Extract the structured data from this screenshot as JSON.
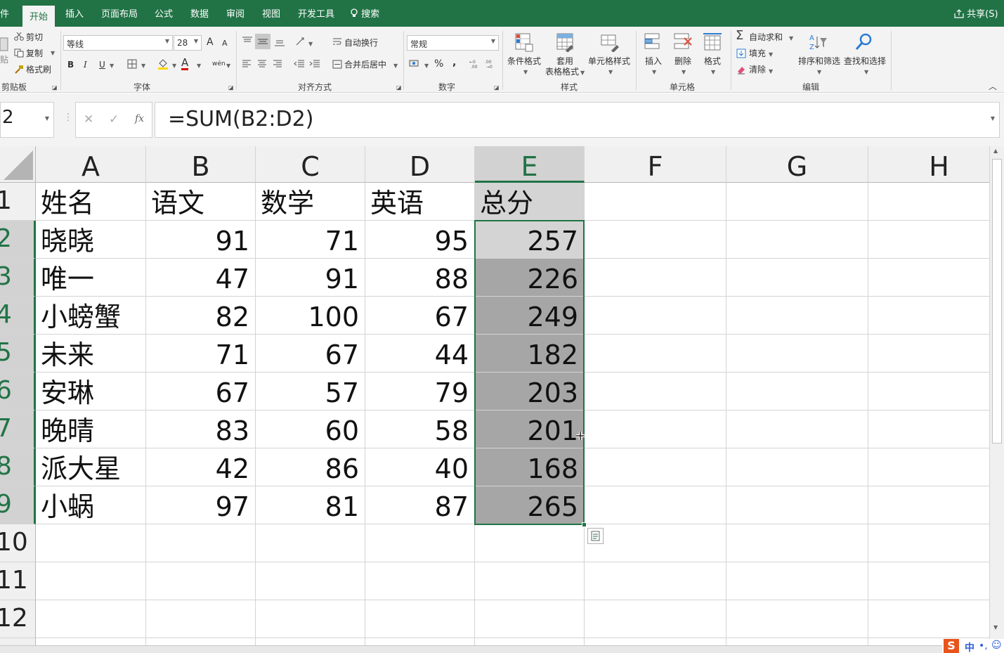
{
  "tabs": [
    {
      "label": "件"
    },
    {
      "label": "开始"
    },
    {
      "label": "插入"
    },
    {
      "label": "页面布局"
    },
    {
      "label": "公式"
    },
    {
      "label": "数据"
    },
    {
      "label": "审阅"
    },
    {
      "label": "视图"
    },
    {
      "label": "开发工具"
    }
  ],
  "search_label": "搜索",
  "share_label": "共享(S)",
  "clipboard": {
    "cut": "剪切",
    "copy": "复制",
    "paste_short": "贴",
    "format_painter": "格式刷",
    "group": "剪贴板"
  },
  "font": {
    "name": "等线",
    "size": "28",
    "bold": "B",
    "italic": "I",
    "underline": "U",
    "grow": "A",
    "shrink": "A",
    "font_color_letter": "A",
    "phonetic": "wén",
    "group": "字体"
  },
  "alignment": {
    "wrap": "自动换行",
    "merge": "合并后居中",
    "group": "对齐方式"
  },
  "number": {
    "format": "常规",
    "percent": "%",
    "comma": ",",
    "group": "数字"
  },
  "styles": {
    "conditional": "条件格式",
    "table_line1": "套用",
    "table_line2": "表格格式",
    "cell_styles": "单元格样式",
    "group": "样式"
  },
  "cells": {
    "insert": "插入",
    "delete": "删除",
    "format": "格式",
    "group": "单元格"
  },
  "editing": {
    "autosum": "自动求和",
    "fill": "填充",
    "clear": "清除",
    "sort": "排序和筛选",
    "find": "查找和选择",
    "group": "编辑"
  },
  "namebox": "2",
  "formula": "=SUM(B2:D2)",
  "columns": [
    "A",
    "B",
    "C",
    "D",
    "E",
    "F",
    "G",
    "H"
  ],
  "rows": [
    "1",
    "2",
    "3",
    "4",
    "5",
    "6",
    "7",
    "8",
    "9",
    "10",
    "11",
    "12"
  ],
  "table": {
    "header": [
      "姓名",
      "语文",
      "数学",
      "英语",
      "总分"
    ],
    "rows": [
      [
        "晓晓",
        "91",
        "71",
        "95",
        "257"
      ],
      [
        "唯一",
        "47",
        "91",
        "88",
        "226"
      ],
      [
        "小螃蟹",
        "82",
        "100",
        "67",
        "249"
      ],
      [
        "未来",
        "71",
        "67",
        "44",
        "182"
      ],
      [
        "安琳",
        "67",
        "57",
        "79",
        "203"
      ],
      [
        "晚晴",
        "83",
        "60",
        "58",
        "201"
      ],
      [
        "派大星",
        "42",
        "86",
        "40",
        "168"
      ],
      [
        "小蜗",
        "97",
        "81",
        "87",
        "265"
      ]
    ]
  },
  "ime": {
    "logo": "S",
    "lang": "中"
  },
  "colors": {
    "accent": "#217346",
    "selection": "#a6a6a6",
    "header_bg": "#f0f0f0"
  }
}
